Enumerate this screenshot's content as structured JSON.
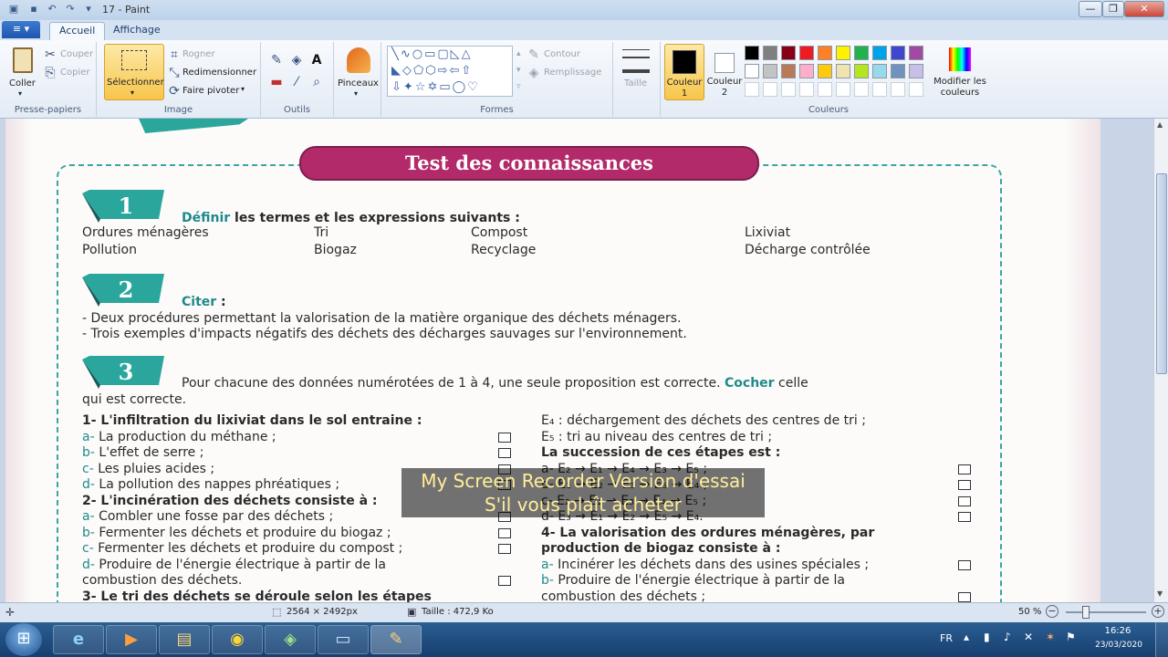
{
  "window": {
    "title": "17 - Paint",
    "controls": [
      "—",
      "❐",
      "✕"
    ]
  },
  "tabs": [
    {
      "label": "Accueil"
    },
    {
      "label": "Affichage"
    }
  ],
  "file_menu": "≡ ▾",
  "ribbon": {
    "clipboard": {
      "paste": "Coller",
      "cut": "Couper",
      "copy": "Copier",
      "label": "Presse-papiers"
    },
    "image": {
      "select": "Sélectionner",
      "crop": "Rogner",
      "resize": "Redimensionner",
      "rotate": "Faire pivoter",
      "label": "Image"
    },
    "tools": {
      "label": "Outils"
    },
    "brushes": {
      "label": "Pinceaux"
    },
    "shapes": {
      "outline": "Contour",
      "fill": "Remplissage",
      "label": "Formes"
    },
    "size": {
      "label": "Taille"
    },
    "colors": {
      "color1": "Couleur 1",
      "color2": "Couleur 2",
      "edit": "Modifier les couleurs",
      "label": "Couleurs",
      "palette": [
        "#000000",
        "#7f7f7f",
        "#880015",
        "#ed1c24",
        "#ff7f27",
        "#fff200",
        "#22b14c",
        "#00a2e8",
        "#3f48cc",
        "#a349a4",
        "#ffffff",
        "#c3c3c3",
        "#b97a57",
        "#ffaec9",
        "#ffc90e",
        "#efe4b0",
        "#b5e61d",
        "#99d9ea",
        "#7092be",
        "#c8bfe7"
      ]
    }
  },
  "document": {
    "heading": "Test des connaissances",
    "s1": {
      "num": "1",
      "verb": "Définir",
      "rest": " les termes et les expressions suivants :",
      "terms": [
        "Ordures ménagères",
        "Tri",
        "Compost",
        "Lixiviat",
        "Pollution",
        "Biogaz",
        "Recyclage",
        "Décharge contrôlée"
      ]
    },
    "s2": {
      "num": "2",
      "verb": "Citer",
      "rest": " :",
      "lines": [
        "- Deux procédures permettant la valorisation de la matière organique des déchets ménagers.",
        "- Trois exemples d'impacts négatifs des déchets des décharges sauvages sur l'environnement."
      ]
    },
    "s3": {
      "num": "3",
      "intro_a": "Pour chacune des données numérotées de 1 à 4, une seule proposition est correcte. ",
      "intro_verb": "Cocher",
      "intro_b": " celle",
      "intro_c": "qui est correcte.",
      "left": [
        {
          "t": "1- L'infiltration du lixiviat dans le sol entraine :",
          "bold": true
        },
        {
          "k": "a-",
          "t": " La production du méthane ;"
        },
        {
          "k": "b-",
          "t": " L'effet de serre ;"
        },
        {
          "k": "c-",
          "t": " Les pluies acides ;"
        },
        {
          "k": "d-",
          "t": " La pollution des nappes phréatiques ;"
        },
        {
          "t": "2- L'incinération des déchets consiste à :",
          "bold": true
        },
        {
          "k": "a-",
          "t": " Combler une fosse par des déchets ;"
        },
        {
          "k": "b-",
          "t": " Fermenter les déchets et produire du biogaz ;"
        },
        {
          "k": "c-",
          "t": " Fermenter les déchets et produire du compost ;"
        },
        {
          "k": "d-",
          "t": "  Produire de l'énergie électrique à partir de la"
        },
        {
          "t": "combustion des déchets."
        },
        {
          "t": "3- Le tri des déchets se déroule selon les étapes",
          "bold": true
        }
      ],
      "right": [
        {
          "t": "E₄ : déchargement des déchets des centres de tri ;"
        },
        {
          "t": "E₅ : tri au niveau des centres de tri ;"
        },
        {
          "t": "La succession de ces étapes est :",
          "bold": true
        },
        {
          "t": "a- E₂ → E₁ → E₄ → E₃ → E₅ ;"
        },
        {
          "t": "b- E₁ → E₂ → E₃ → E₅ → E₄ ;"
        },
        {
          "t": "c- E₂ → E₁ → E₃ → E₄ → E₅ ;"
        },
        {
          "t": "d- E₃ → E₁ → E₂ → E₅ → E₄."
        },
        {
          "t": "4- La valorisation des ordures ménagères, par",
          "bold": true
        },
        {
          "t": "production de biogaz consiste à :",
          "bold": true
        },
        {
          "k": "a-",
          "t": " Incinérer les déchets dans des usines spéciales ;"
        },
        {
          "k": "b-",
          "t": " Produire de l'énergie électrique à partir de la"
        },
        {
          "t": "combustion des déchets ;"
        }
      ]
    }
  },
  "watermark": {
    "line1": "My Screen Recorder Version d'essai",
    "line2": "S'il vous plaît acheter"
  },
  "status": {
    "dimensions": "2564 × 2492px",
    "size": "Taille : 472,9 Ko",
    "zoom": "50 %"
  },
  "tray": {
    "lang": "FR",
    "time": "16:26",
    "date": "23/03/2020"
  }
}
